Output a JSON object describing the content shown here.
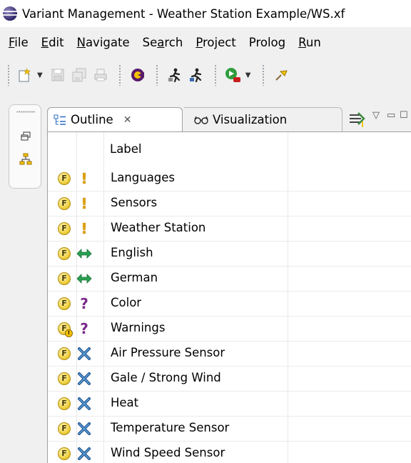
{
  "window": {
    "title": "Variant Management - Weather Station Example/WS.xf",
    "icon": "eclipse-icon"
  },
  "menu": [
    {
      "mnemonic": "F",
      "rest": "ile"
    },
    {
      "mnemonic": "E",
      "rest": "dit"
    },
    {
      "mnemonic": "N",
      "rest": "avigate"
    },
    {
      "pre": "Se",
      "mnemonic": "a",
      "rest": "rch"
    },
    {
      "mnemonic": "P",
      "rest": "roject"
    },
    {
      "plain": "Prolog"
    },
    {
      "mnemonic": "R",
      "rest": "un"
    }
  ],
  "toolbar": {
    "icons": [
      "new-icon",
      "save-icon",
      "save-all-icon",
      "print-icon",
      "feature-ide-icon",
      "runner-icon",
      "runner-alt-icon",
      "run-icon",
      "pin-icon"
    ]
  },
  "side_trim": {
    "icons": [
      "restore-icon",
      "hierarchy-icon"
    ]
  },
  "tabs": {
    "outline": {
      "label": "Outline",
      "icon": "outline-icon",
      "close": "✕"
    },
    "visualization": {
      "label": "Visualization",
      "icon": "glasses-icon"
    },
    "more_icon": "show-list-icon"
  },
  "table": {
    "header": "Label",
    "rows": [
      {
        "label": "Languages",
        "feature": "F",
        "state": "!",
        "kind": "excl",
        "feature_warn": false
      },
      {
        "label": "Sensors",
        "feature": "F",
        "state": "!",
        "kind": "excl",
        "feature_warn": false
      },
      {
        "label": "Weather Station",
        "feature": "F",
        "state": "!",
        "kind": "excl",
        "feature_warn": false
      },
      {
        "label": "English",
        "feature": "F",
        "state": "⇔",
        "kind": "alt",
        "feature_warn": false
      },
      {
        "label": "German",
        "feature": "F",
        "state": "⇔",
        "kind": "alt",
        "feature_warn": false
      },
      {
        "label": "Color",
        "feature": "F",
        "state": "?",
        "kind": "quest",
        "feature_warn": false
      },
      {
        "label": "Warnings",
        "feature": "F",
        "state": "?",
        "kind": "quest",
        "feature_warn": true
      },
      {
        "label": "Air Pressure Sensor",
        "feature": "F",
        "state": "✖",
        "kind": "cross",
        "feature_warn": false
      },
      {
        "label": "Gale / Strong Wind",
        "feature": "F",
        "state": "✖",
        "kind": "cross",
        "feature_warn": false
      },
      {
        "label": "Heat",
        "feature": "F",
        "state": "✖",
        "kind": "cross",
        "feature_warn": false
      },
      {
        "label": "Temperature Sensor",
        "feature": "F",
        "state": "✖",
        "kind": "cross",
        "feature_warn": false
      },
      {
        "label": "Wind Speed Sensor",
        "feature": "F",
        "state": "✖",
        "kind": "cross",
        "feature_warn": false
      }
    ]
  }
}
